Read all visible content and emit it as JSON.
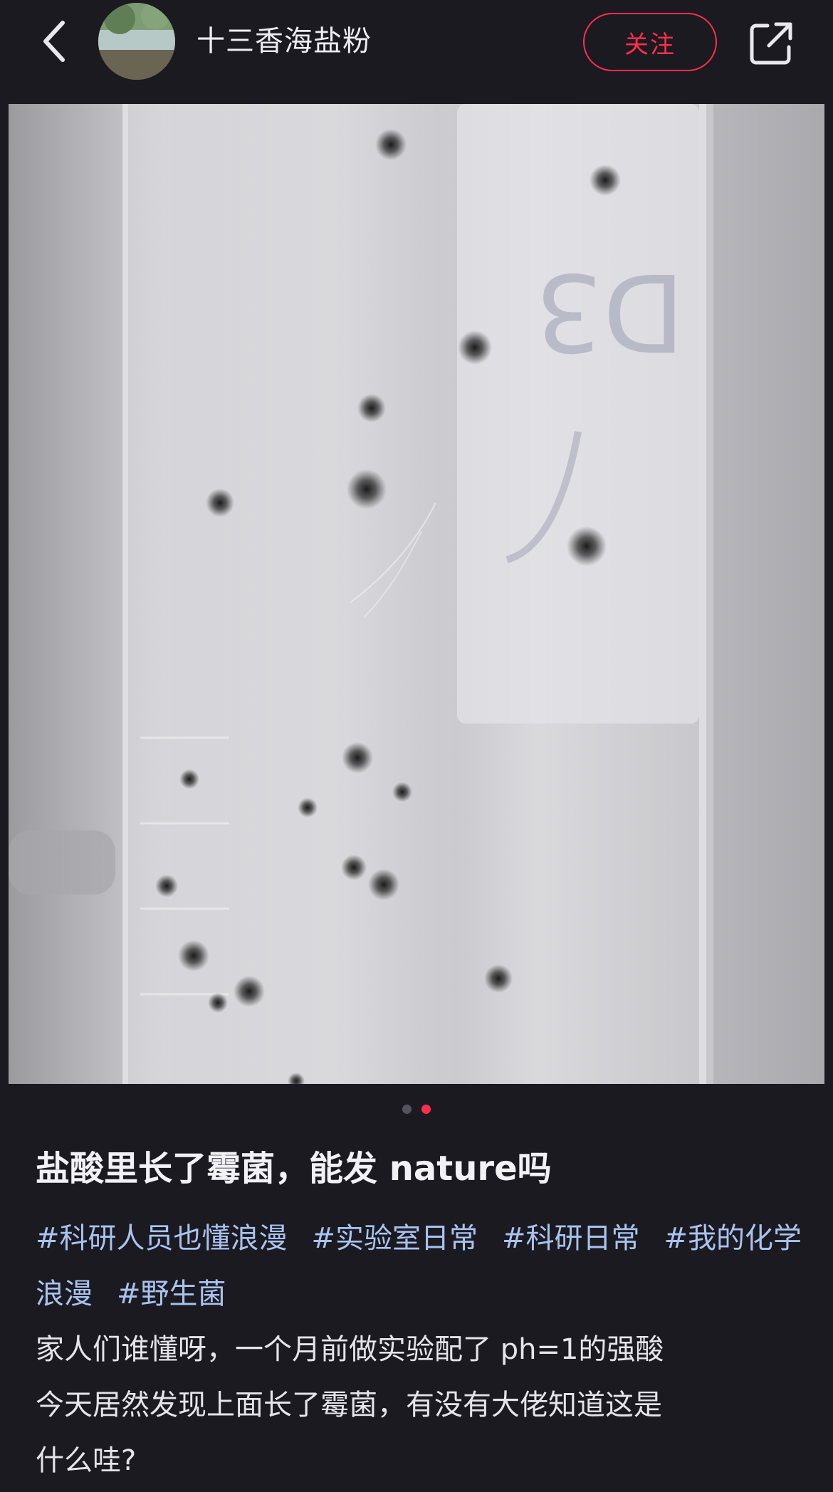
{
  "header": {
    "username": "十三香海盐粉",
    "follow_label": "关注"
  },
  "carousel": {
    "count": 2,
    "active_index": 1
  },
  "post": {
    "title": "盐酸里长了霉菌，能发 nature吗",
    "tags": [
      "#科研人员也懂浪漫",
      "#实验室日常",
      "#科研日常",
      "#我的化学浪漫",
      "#野生菌"
    ],
    "body_lines": [
      "家人们谁懂呀，一个月前做实验配了 ph=1的强酸",
      "今天居然发现上面长了霉菌，有没有大佬知道这是",
      "什么哇?"
    ]
  },
  "colors": {
    "background": "#1b1a21",
    "accent": "#ff2e4d",
    "tag": "#a9c3ef"
  },
  "icons": [
    "back-arrow-icon",
    "share-icon"
  ]
}
